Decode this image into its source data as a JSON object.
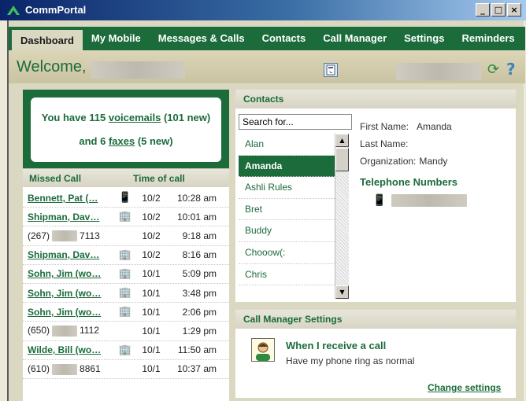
{
  "window": {
    "title": "CommPortal",
    "controls": {
      "minimize": "_",
      "maximize": "□",
      "close": "×"
    }
  },
  "tabs": [
    {
      "label": "Dashboard",
      "active": true
    },
    {
      "label": "My Mobile"
    },
    {
      "label": "Messages & Calls"
    },
    {
      "label": "Contacts"
    },
    {
      "label": "Call Manager"
    },
    {
      "label": "Settings"
    },
    {
      "label": "Reminders"
    }
  ],
  "header": {
    "welcome": "Welcome,",
    "refresh_glyph": "⟳",
    "help_glyph": "?"
  },
  "voicemail": {
    "prefix": "You have ",
    "vm_count": "115",
    "vm_link": "voicemails",
    "vm_suffix": " (101 new)",
    "fax_prefix": "and  6 ",
    "fax_link": "faxes",
    "fax_suffix": " (5 new)"
  },
  "missed_calls": {
    "col_caller": "Missed Call",
    "col_time": "Time of call",
    "rows": [
      {
        "name": "Bennett, Pat (…",
        "link": true,
        "icon": "mobile-icon",
        "date": "10/2",
        "time": "10:28 am"
      },
      {
        "name": "Shipman, Dav…",
        "link": true,
        "icon": "office-icon",
        "date": "10/2",
        "time": "10:01 am"
      },
      {
        "area": "(267)",
        "tail": "7113",
        "link": false,
        "icon": "",
        "date": "10/2",
        "time": "9:18 am"
      },
      {
        "name": "Shipman, Dav…",
        "link": true,
        "icon": "office-icon",
        "date": "10/2",
        "time": "8:16 am"
      },
      {
        "name": "Sohn, Jim (wo…",
        "link": true,
        "icon": "office-icon",
        "date": "10/1",
        "time": "5:09 pm"
      },
      {
        "name": "Sohn, Jim (wo…",
        "link": true,
        "icon": "office-icon",
        "date": "10/1",
        "time": "3:48 pm"
      },
      {
        "name": "Sohn, Jim (wo…",
        "link": true,
        "icon": "office-icon",
        "date": "10/1",
        "time": "2:06 pm"
      },
      {
        "area": "(650)",
        "tail": "1112",
        "link": false,
        "icon": "",
        "date": "10/1",
        "time": "1:29 pm"
      },
      {
        "name": "Wilde, Bill (wo…",
        "link": true,
        "icon": "office-icon",
        "date": "10/1",
        "time": "11:50 am"
      },
      {
        "area": "(610)",
        "tail": "8861",
        "link": false,
        "icon": "",
        "date": "10/1",
        "time": "10:37 am"
      }
    ]
  },
  "contacts": {
    "title": "Contacts",
    "search_value": "Search for...",
    "list": [
      "Alan",
      "Amanda",
      "Ashli Rules",
      "Bret",
      "Buddy",
      "Chooow(:",
      "Chris"
    ],
    "selected_index": 1,
    "scroll_up": "▲",
    "scroll_down": "▼",
    "detail": {
      "first_name_label": "First Name:",
      "first_name": "Amanda",
      "last_name_label": "Last Name:",
      "last_name": "",
      "org_label": "Organization:",
      "org": "Mandy",
      "tel_title": "Telephone Numbers"
    }
  },
  "call_manager": {
    "title": "Call Manager Settings",
    "rule_title": "When I receive a call",
    "rule_desc": "Have my phone ring as normal",
    "change_link": "Change settings"
  }
}
